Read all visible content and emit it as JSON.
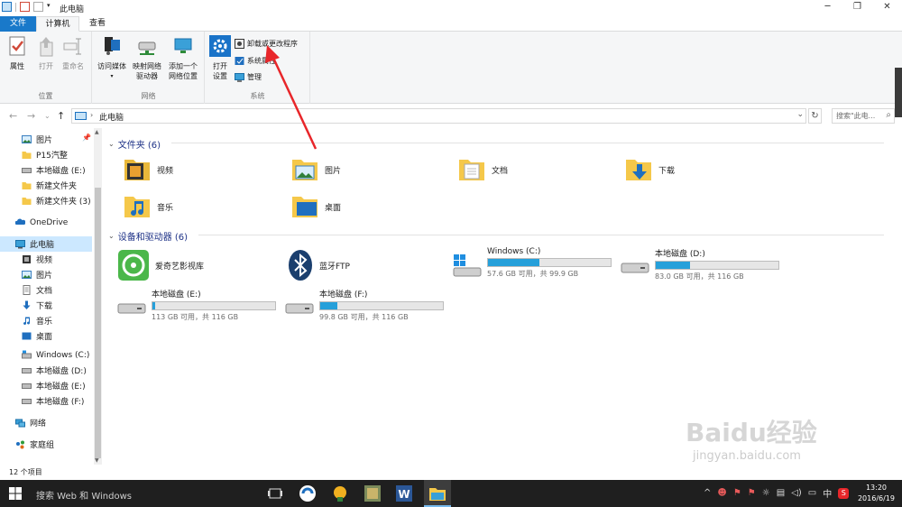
{
  "window": {
    "title": "此电脑"
  },
  "ribbon_tabs": [
    "文件",
    "计算机",
    "查看"
  ],
  "ribbon": {
    "location": {
      "label": "位置",
      "buttons": [
        "属性",
        "打开",
        "重命名"
      ]
    },
    "network": {
      "label": "网络",
      "access_media": "访问媒体",
      "map_drive_1": "映射网络",
      "map_drive_2": "驱动器",
      "add_loc_1": "添加一个",
      "add_loc_2": "网络位置"
    },
    "system": {
      "label": "系统",
      "open_settings_1": "打开",
      "open_settings_2": "设置",
      "uninstall": "卸载或更改程序",
      "system_props": "系统属性",
      "manage": "管理"
    }
  },
  "address": {
    "path": "此电脑",
    "search_placeholder": "搜索\"此电..."
  },
  "sidebar": {
    "items": [
      {
        "label": "图片"
      },
      {
        "label": "P15汽整"
      },
      {
        "label": "本地磁盘 (E:)"
      },
      {
        "label": "新建文件夹"
      },
      {
        "label": "新建文件夹 (3)"
      },
      {
        "label": "OneDrive"
      },
      {
        "label": "此电脑"
      },
      {
        "label": "视频"
      },
      {
        "label": "图片"
      },
      {
        "label": "文档"
      },
      {
        "label": "下载"
      },
      {
        "label": "音乐"
      },
      {
        "label": "桌面"
      },
      {
        "label": "Windows (C:)"
      },
      {
        "label": "本地磁盘 (D:)"
      },
      {
        "label": "本地磁盘 (E:)"
      },
      {
        "label": "本地磁盘 (F:)"
      },
      {
        "label": "网络"
      },
      {
        "label": "家庭组"
      }
    ]
  },
  "main": {
    "folders_header": "文件夹 (6)",
    "folders": [
      {
        "label": "视频"
      },
      {
        "label": "图片"
      },
      {
        "label": "文档"
      },
      {
        "label": "下载"
      },
      {
        "label": "音乐"
      },
      {
        "label": "桌面"
      }
    ],
    "devices_header": "设备和驱动器 (6)",
    "apps": [
      {
        "label": "爱奇艺影视库"
      },
      {
        "label": "蓝牙FTP"
      }
    ],
    "drives": [
      {
        "label": "Windows (C:)",
        "free": "57.6 GB 可用，共 99.9 GB",
        "used_fraction": 0.42
      },
      {
        "label": "本地磁盘 (D:)",
        "free": "83.0 GB 可用，共 116 GB",
        "used_fraction": 0.28
      },
      {
        "label": "本地磁盘 (E:)",
        "free": "113 GB 可用，共 116 GB",
        "used_fraction": 0.02
      },
      {
        "label": "本地磁盘 (F:)",
        "free": "99.8 GB 可用，共 116 GB",
        "used_fraction": 0.14
      }
    ]
  },
  "status": {
    "count": "12 个项目"
  },
  "taskbar": {
    "search": "搜索 Web 和 Windows",
    "ime": "中",
    "time": "13:20",
    "date": "2016/6/19"
  },
  "watermark": {
    "text": "Baidu经验",
    "url": "jingyan.baidu.com"
  },
  "colors": {
    "accent": "#1979ca",
    "drive_bar": "#26a0da",
    "arrow": "#e8262a",
    "folder": "#f5c84a"
  }
}
